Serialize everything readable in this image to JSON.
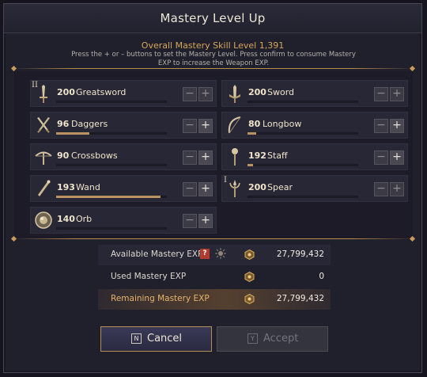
{
  "dialog": {
    "title": "Mastery Level Up",
    "summary": "Overall Mastery Skill Level 1,391",
    "instructions": "Press the + or – buttons to set the Mastery Level. Press confirm to consume Mastery EXP to increase the Weapon EXP."
  },
  "weapons": [
    {
      "level": "200",
      "name": "Greatsword",
      "progress": 0,
      "icon": "greatsword-icon",
      "rank": "II"
    },
    {
      "level": "200",
      "name": "Sword",
      "progress": 0,
      "icon": "sword-icon"
    },
    {
      "level": "96",
      "name": "Daggers",
      "progress": 0.3,
      "icon": "daggers-icon"
    },
    {
      "level": "80",
      "name": "Longbow",
      "progress": 0.08,
      "icon": "longbow-icon"
    },
    {
      "level": "90",
      "name": "Crossbows",
      "progress": 0,
      "icon": "crossbow-icon"
    },
    {
      "level": "192",
      "name": "Staff",
      "progress": 0.05,
      "icon": "staff-icon"
    },
    {
      "level": "193",
      "name": "Wand",
      "progress": 0.94,
      "icon": "wand-icon"
    },
    {
      "level": "200",
      "name": "Spear",
      "progress": 0,
      "icon": "spear-icon",
      "rank": "I"
    },
    {
      "level": "140",
      "name": "Orb",
      "progress": 0,
      "icon": "orb-icon"
    }
  ],
  "stepper": {
    "minus": "−",
    "plus": "+"
  },
  "exp": {
    "available_label": "Available Mastery EXP",
    "help": "?",
    "available_value": "27,799,432",
    "used_label": "Used Mastery EXP",
    "used_value": "0",
    "remaining_label": "Remaining Mastery EXP",
    "remaining_value": "27,799,432"
  },
  "buttons": {
    "cancel_key": "N",
    "cancel_label": "Cancel",
    "accept_key": "Y",
    "accept_label": "Accept"
  },
  "colors": {
    "accent_gold": "#d6a55a",
    "remaining_row": "#4a3b30"
  }
}
